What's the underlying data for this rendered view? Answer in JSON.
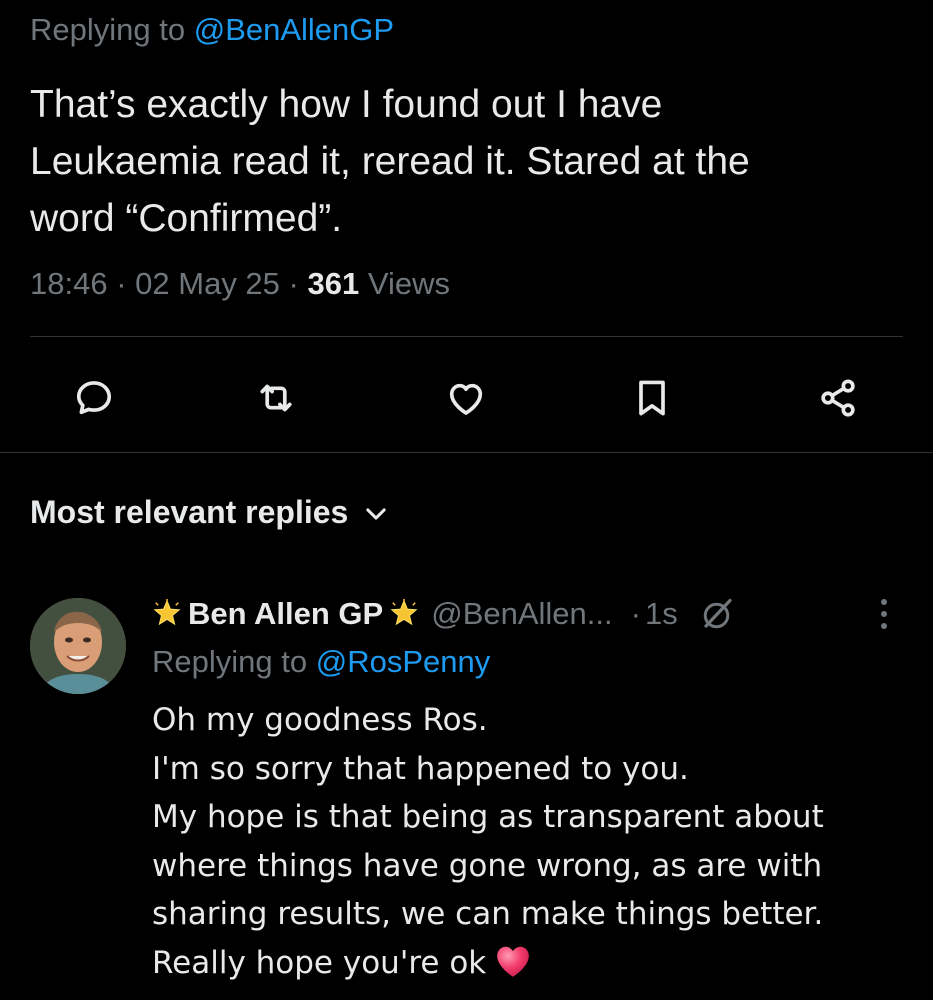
{
  "tweet": {
    "replying_prefix": "Replying to",
    "replying_handle": "@BenAllenGP",
    "text_lines": [
      "That’s exactly how I found out I have",
      "Leukaemia  read it, reread it. Stared at the",
      "word “Confirmed”."
    ],
    "time": "18:46",
    "date": "02 May 25",
    "views_count": "361",
    "views_label": "Views",
    "separator": "·"
  },
  "actions": {
    "reply_icon": "reply-icon",
    "retweet_icon": "retweet-icon",
    "like_icon": "heart-icon",
    "bookmark_icon": "bookmark-icon",
    "share_icon": "share-icon"
  },
  "replies_section": {
    "sort_label": "Most relevant replies"
  },
  "reply": {
    "display_name": "Ben Allen GP",
    "handle": "@BenAllen...",
    "separator": "·",
    "time": "1s",
    "replying_prefix": "Replying to",
    "replying_handle": "@RosPenny",
    "text_lines": [
      "Oh my goodness Ros.",
      "I'm so sorry that happened to you.",
      "My hope is that being as transparent about",
      "where things have gone wrong, as are with",
      "sharing results, we can make things better.",
      "Really hope you're ok"
    ],
    "emoji": "heart-emoji"
  },
  "colors": {
    "background": "#000000",
    "text": "#e7e9ea",
    "muted": "#71767b",
    "link": "#1d9bf0",
    "divider": "#2f3336",
    "heart": "#f23b6b"
  }
}
